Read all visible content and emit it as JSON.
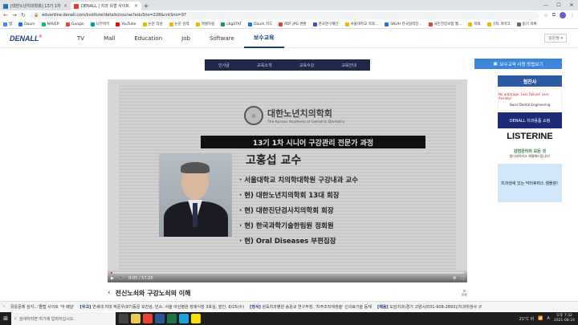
{
  "browser": {
    "tabs": [
      {
        "title": "[대한노년치의학회] 13기 1차 시니",
        "active": false,
        "color": "#2b6cb0"
      },
      {
        "title": "DENALL | 치과 유형 사이트",
        "active": true,
        "color": "#e53935"
      }
    ],
    "new_tab": "+",
    "url": "eduonline.denall.com/institute/details/course?eduSno=228&cntSno=97",
    "bookmarks": [
      {
        "label": "앱",
        "color": "#4285f4"
      },
      {
        "label": "Daum",
        "color": "#1a73e8"
      },
      {
        "label": "NAVER",
        "color": "#03c75a"
      },
      {
        "label": "Google",
        "color": "#ea4335"
      },
      {
        "label": "나무위키",
        "color": "#00a495"
      },
      {
        "label": "YouTube",
        "color": "#ff0000"
      },
      {
        "label": "논문 작성",
        "color": "#f4b400"
      },
      {
        "label": "논문 검색",
        "color": "#f4b400"
      },
      {
        "label": "엑셀하실",
        "color": "#f4b400"
      },
      {
        "label": "cbgSTAT",
        "color": "#0f9d58"
      },
      {
        "label": "Daum 지도",
        "color": "#1a73e8"
      },
      {
        "label": "PDF JPG 변환",
        "color": "#db4437"
      },
      {
        "label": "한국연구재단",
        "color": "#3f51b5"
      },
      {
        "label": "서울대학교 치과...",
        "color": "#f4b400"
      },
      {
        "label": "SNUH 한국협력진...",
        "color": "#1a73e8"
      },
      {
        "label": "국민건강보험 웹...",
        "color": "#db4437"
      },
      {
        "label": "학회",
        "color": "#f4b400"
      },
      {
        "label": "기타 북마크",
        "color": "#f4b400"
      },
      {
        "label": "읽기 목록",
        "color": "#666666"
      }
    ]
  },
  "site": {
    "logo": "DENALL",
    "logo_mark": "®",
    "nav": [
      {
        "label": "TV",
        "active": false
      },
      {
        "label": "Mall",
        "active": false
      },
      {
        "label": "Education",
        "active": false
      },
      {
        "label": "Job",
        "active": false
      },
      {
        "label": "Software",
        "active": false
      },
      {
        "label": "보수교육",
        "active": true
      }
    ],
    "login": "김은정 ▾",
    "subnav": [
      "인사글",
      "교육소개",
      "교육수강",
      "교육안내"
    ],
    "help_button": "보수교육 사용 방법보기"
  },
  "video": {
    "org_name_ko": "대한노년치의학회",
    "org_name_en": "The Korean Academy of Geriatric Dentistry",
    "banner": "13기 1차 시니어 구강관리 전문가 과정",
    "speaker": "고홍섭 교수",
    "credentials": [
      "· 서울대학교 치의학대학원 구강내과 교수",
      "· 현) 대한노년치의학회 13대 회장",
      "· 현) 대한진단검사치의학회 회장",
      "· 현) 한국과학기술한림원 정회원",
      "· 현) Oral Diseases 부편집장"
    ],
    "time": "0:05 / 57:25",
    "progress": 0.0015,
    "title": "전신노쇠와 구강노쇠의 이해",
    "list_label": "목록"
  },
  "sidebar": {
    "title": "협찬사",
    "ads": [
      {
        "name": "Swiss Dental Engineering",
        "text": "No arbitrage. Less Failure! Less Anxiety!"
      },
      {
        "name": "DENALL",
        "text": "DENALL 치과용품 쇼핑"
      },
      {
        "name": "LISTERINE",
        "text": "LISTERINE"
      },
      {
        "name": "감염관리",
        "text": "감염관리의 모든 것",
        "sub": "앱디세이미크 해결해드립니다!"
      },
      {
        "name": "치과생새",
        "text": "치과생새 있는 닥터휴머스 샘플분!"
      }
    ]
  },
  "ticker": [
    {
      "tag": "",
      "text": "뮤틀문제 심각...'똘랩 사이트 '악 배달'"
    },
    {
      "tag": "[우고]",
      "text": "연세대 치대 박준우(87)동문 모친상, 빈소: 서울 아산병원 장례식장 3호실, 발인: 8/25(수)"
    },
    {
      "tag": "[정서]",
      "text": "삼육치과병원 송윤규 연구부장, '치주조직재생술' 신의료기술 등재"
    },
    {
      "tag": "[채용]",
      "text": "도담치과(경기 고양시/031-908-2893)/치과위생사 구"
    }
  ],
  "taskbar": {
    "search": "검색하려면 여기에 입력하십시오.",
    "weather": "21°C 비",
    "lang": "A",
    "time": "오후 7:32",
    "date": "2021-08-24"
  }
}
